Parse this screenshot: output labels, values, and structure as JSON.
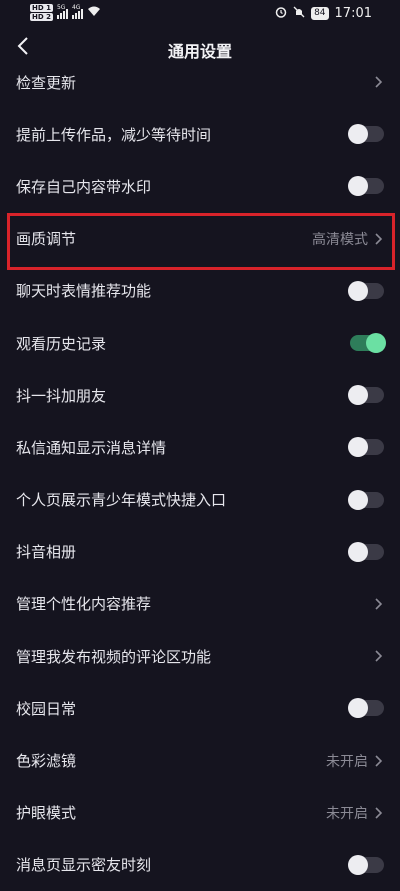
{
  "status_bar": {
    "sim1": "HD 1",
    "sim2": "HD 2",
    "net1": "5G",
    "net2": "4G",
    "battery": "84",
    "time": "17:01"
  },
  "nav": {
    "title": "通用设置"
  },
  "rows": [
    {
      "label": "检查更新",
      "type": "chevron"
    },
    {
      "label": "提前上传作品，减少等待时间",
      "type": "toggle",
      "on": false
    },
    {
      "label": "保存自己内容带水印",
      "type": "toggle",
      "on": false
    },
    {
      "label": "画质调节",
      "type": "value",
      "value": "高清模式",
      "highlighted": true
    },
    {
      "label": "聊天时表情推荐功能",
      "type": "toggle",
      "on": false
    },
    {
      "label": "观看历史记录",
      "type": "toggle",
      "on": true
    },
    {
      "label": "抖一抖加朋友",
      "type": "toggle",
      "on": false
    },
    {
      "label": "私信通知显示消息详情",
      "type": "toggle",
      "on": false
    },
    {
      "label": "个人页展示青少年模式快捷入口",
      "type": "toggle",
      "on": false
    },
    {
      "label": "抖音相册",
      "type": "toggle",
      "on": false
    },
    {
      "label": "管理个性化内容推荐",
      "type": "chevron"
    },
    {
      "label": "管理我发布视频的评论区功能",
      "type": "chevron"
    },
    {
      "label": "校园日常",
      "type": "toggle",
      "on": false
    },
    {
      "label": "色彩滤镜",
      "type": "value",
      "value": "未开启"
    },
    {
      "label": "护眼模式",
      "type": "value",
      "value": "未开启"
    },
    {
      "label": "消息页显示密友时刻",
      "type": "toggle",
      "on": false
    }
  ],
  "colors": {
    "background": "#15141f",
    "toggle_on": "#6be0a3",
    "highlight_border": "#d8232a"
  }
}
